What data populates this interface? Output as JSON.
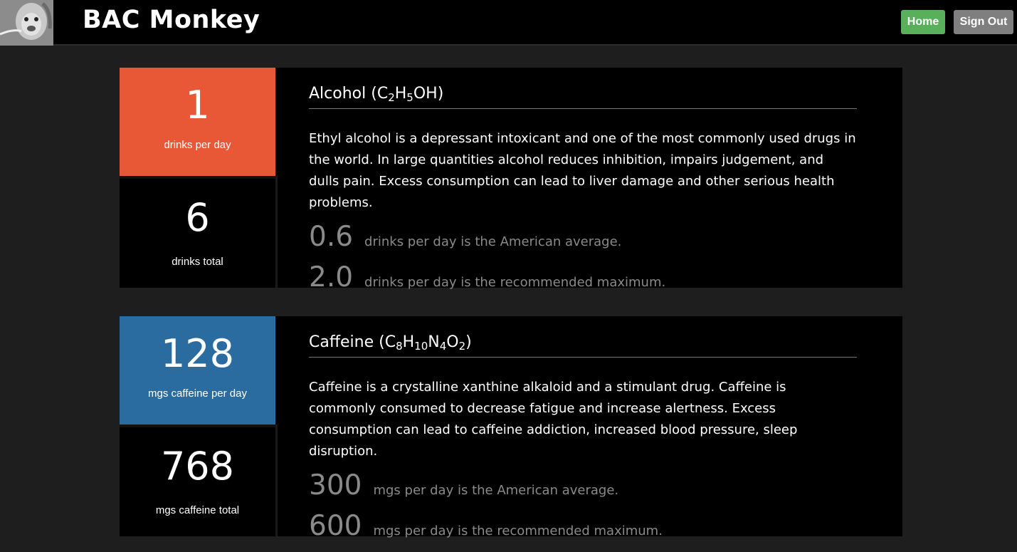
{
  "header": {
    "app_title": "BAC Monkey",
    "home_label": "Home",
    "signout_label": "Sign Out"
  },
  "cards": [
    {
      "rate_value": "1",
      "rate_label": "drinks per day",
      "total_value": "6",
      "total_label": "drinks total",
      "title": "Alcohol (",
      "formula": [
        {
          "t": "C"
        },
        {
          "s": "2"
        },
        {
          "t": "H"
        },
        {
          "s": "5"
        },
        {
          "t": "OH)"
        }
      ],
      "description": "Ethyl alcohol is a depressant intoxicant and one of the most commonly used drugs in the world. In large quantities alcohol reduces inhibition, impairs judgement, and dulls pain. Excess consumption can lead to liver damage and other serious health problems.",
      "avg_value": "0.6",
      "avg_text": "drinks per day is the American average.",
      "max_value": "2.0",
      "max_text": "drinks per day is the recommended maximum.",
      "accent_color": "#e85736"
    },
    {
      "rate_value": "128",
      "rate_label": "mgs caffeine per day",
      "total_value": "768",
      "total_label": "mgs caffeine total",
      "title": "Caffeine (",
      "formula": [
        {
          "t": "C"
        },
        {
          "s": "8"
        },
        {
          "t": "H"
        },
        {
          "s": "10"
        },
        {
          "t": "N"
        },
        {
          "s": "4"
        },
        {
          "t": "O"
        },
        {
          "s": "2"
        },
        {
          "t": ")"
        }
      ],
      "description": "Caffeine is a crystalline xanthine alkaloid and a stimulant drug. Caffeine is commonly consumed to decrease fatigue and increase alertness. Excess consumption can lead to caffeine addiction, increased blood pressure, sleep disruption.",
      "avg_value": "300",
      "avg_text": "mgs per day is the American average.",
      "max_value": "600",
      "max_text": "mgs per day is the recommended maximum.",
      "accent_color": "#2b6ca0"
    }
  ],
  "icons": {
    "logo": "monkey-logo-icon"
  }
}
